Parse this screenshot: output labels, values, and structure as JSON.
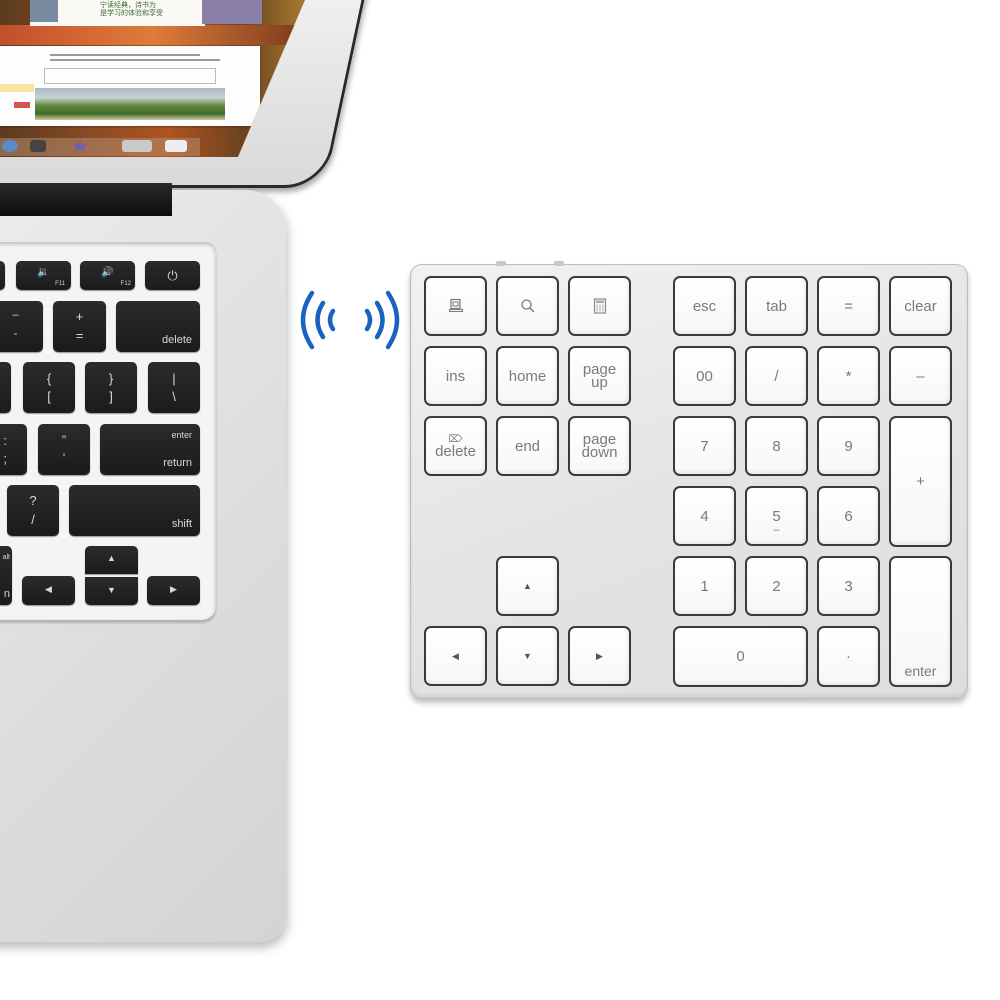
{
  "scene": {
    "description": "Product photo: wireless numeric keypad connected to a laptop via bluetooth",
    "accent_color": "#1565c0",
    "keypad_color": "#e6e6e6",
    "laptop_key_color": "#1e1e1e"
  },
  "laptop": {
    "screen": {
      "doc_text": "宁读经典，诗书为\n是学习的体验和享受",
      "dock_icons": [
        "app-store-icon",
        "clock-icon",
        "imovie-icon",
        "folder-icon",
        "trash-icon"
      ]
    },
    "keys": [
      {
        "id": "f11",
        "icon": "volume-down-icon",
        "label": "F11"
      },
      {
        "id": "f12",
        "icon": "volume-up-icon",
        "label": "F12"
      },
      {
        "id": "power",
        "icon": "power-icon",
        "label": "⏻"
      },
      {
        "id": "minus",
        "top": "–",
        "bottom": "-"
      },
      {
        "id": "equals",
        "top": "+",
        "bottom": "="
      },
      {
        "id": "delete",
        "label": "delete"
      },
      {
        "id": "bracket-left-partial",
        "top": "",
        "bottom": ""
      },
      {
        "id": "bracket-left",
        "top": "{",
        "bottom": "["
      },
      {
        "id": "bracket-right",
        "top": "}",
        "bottom": "]"
      },
      {
        "id": "backslash",
        "top": "|",
        "bottom": "\\"
      },
      {
        "id": "semicolon",
        "top": ":",
        "bottom": ";"
      },
      {
        "id": "quote",
        "top": "\"",
        "bottom": "'"
      },
      {
        "id": "return",
        "top": "enter",
        "bottom": "return"
      },
      {
        "id": "slash",
        "top": "?",
        "bottom": "/"
      },
      {
        "id": "shift",
        "label": "shift"
      },
      {
        "id": "option-partial",
        "top": "alt",
        "bottom": "n"
      },
      {
        "id": "arrow-left",
        "label": "◀"
      },
      {
        "id": "arrow-up",
        "label": "▲"
      },
      {
        "id": "arrow-down",
        "label": "▼"
      },
      {
        "id": "arrow-right",
        "label": "▶"
      }
    ]
  },
  "bluetooth": {
    "icon": "wireless-signal-icon"
  },
  "keypad": {
    "left_block": [
      {
        "id": "mycomputer",
        "icon": "my-computer-icon"
      },
      {
        "id": "search",
        "icon": "search-icon"
      },
      {
        "id": "calculator",
        "icon": "calculator-icon"
      },
      {
        "id": "ins",
        "label": "ins"
      },
      {
        "id": "home",
        "label": "home"
      },
      {
        "id": "pageup",
        "line1": "page",
        "line2": "up"
      },
      {
        "id": "delete",
        "icon_text": "⌦",
        "label": "delete"
      },
      {
        "id": "end",
        "label": "end"
      },
      {
        "id": "pagedown",
        "line1": "page",
        "line2": "down"
      },
      {
        "id": "up",
        "label": "▲"
      },
      {
        "id": "left",
        "label": "◀"
      },
      {
        "id": "down",
        "label": "▼"
      },
      {
        "id": "right",
        "label": "▶"
      }
    ],
    "right_block": [
      {
        "id": "esc",
        "label": "esc"
      },
      {
        "id": "tab",
        "label": "tab"
      },
      {
        "id": "equals",
        "label": "="
      },
      {
        "id": "clear",
        "label": "clear"
      },
      {
        "id": "00",
        "label": "00"
      },
      {
        "id": "divide",
        "label": "/"
      },
      {
        "id": "multiply",
        "label": "*"
      },
      {
        "id": "minus",
        "label": "–"
      },
      {
        "id": "7",
        "label": "7"
      },
      {
        "id": "8",
        "label": "8"
      },
      {
        "id": "9",
        "label": "9"
      },
      {
        "id": "plus",
        "label": "+"
      },
      {
        "id": "4",
        "label": "4"
      },
      {
        "id": "5",
        "label": "5",
        "sub": "–"
      },
      {
        "id": "6",
        "label": "6"
      },
      {
        "id": "1",
        "label": "1"
      },
      {
        "id": "2",
        "label": "2"
      },
      {
        "id": "3",
        "label": "3"
      },
      {
        "id": "enter",
        "label": "enter"
      },
      {
        "id": "0",
        "label": "0"
      },
      {
        "id": "decimal",
        "label": "·"
      }
    ]
  }
}
